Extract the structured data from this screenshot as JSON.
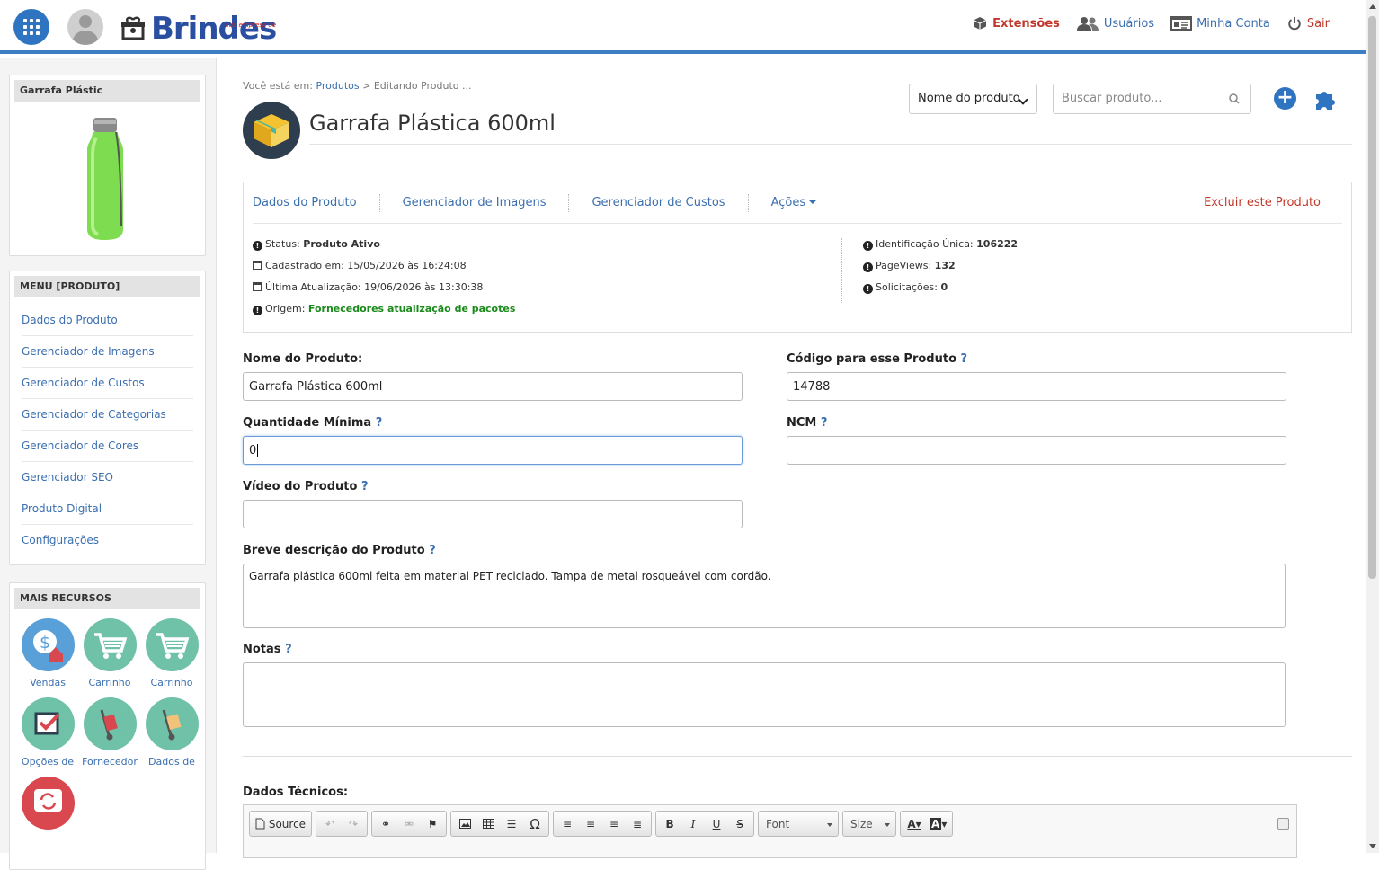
{
  "topnav": {
    "logo_text": "Brindes",
    "logo_sub": "sua empresa de",
    "extensions": "Extensões",
    "users": "Usuários",
    "account": "Minha Conta",
    "logout": "Sair"
  },
  "sidebar": {
    "product_box_title": "Garrafa Plástic",
    "menu_title": "MENU [PRODUTO]",
    "menu_items": [
      "Dados do Produto",
      "Gerenciador de Imagens",
      "Gerenciador de Custos",
      "Gerenciador de Categorias",
      "Gerenciador de Cores",
      "Gerenciador SEO",
      "Produto Digital",
      "Configurações"
    ],
    "resources_title": "MAIS RECURSOS",
    "resources": [
      "Vendas",
      "Carrinho",
      "Carrinho",
      "Opções de",
      "Fornecedor",
      "Dados de"
    ]
  },
  "breadcrumb": {
    "prefix": "Você está em:",
    "link": "Produtos",
    "current": "> Editando Produto ..."
  },
  "page_title": "Garrafa Plástica 600ml",
  "search": {
    "select_value": "Nome do produto",
    "placeholder": "Buscar produto..."
  },
  "tabs": {
    "items": [
      "Dados do Produto",
      "Gerenciador de Imagens",
      "Gerenciador de Custos",
      "Ações"
    ],
    "delete": "Excluir este Produto"
  },
  "info": {
    "status_label": "Status:",
    "status_value": "Produto Ativo",
    "created_label": "Cadastrado em:",
    "created_value": "15/05/2026 às 16:24:08",
    "updated_label": "Última Atualização:",
    "updated_value": "19/06/2026 às 13:30:38",
    "origin_label": "Origem:",
    "origin_value": "Fornecedores atualização de pacotes",
    "id_label": "Identificação Única:",
    "id_value": "106222",
    "views_label": "PageViews:",
    "views_value": "132",
    "requests_label": "Solicitações:",
    "requests_value": "0"
  },
  "form": {
    "name_label": "Nome do Produto:",
    "name_value": "Garrafa Plástica 600ml",
    "code_label": "Código para esse Produto",
    "code_value": "14788",
    "min_label": "Quantidade Mínima",
    "min_value": "0",
    "ncm_label": "NCM",
    "ncm_value": "",
    "video_label": "Vídeo do Produto",
    "video_value": "",
    "desc_label": "Breve descrição do Produto",
    "desc_value": "Garrafa plástica 600ml feita em material PET reciclado. Tampa de metal rosqueável com cordão.",
    "notes_label": "Notas",
    "notes_value": "",
    "help": "?",
    "tech_label": "Dados Técnicos:"
  },
  "editor": {
    "source": "Source",
    "font": "Font",
    "size": "Size"
  },
  "colors": {
    "accent": "#3b7ec4",
    "link": "#3b6fb0",
    "danger": "#c0392b",
    "success": "#1a8a1a"
  }
}
